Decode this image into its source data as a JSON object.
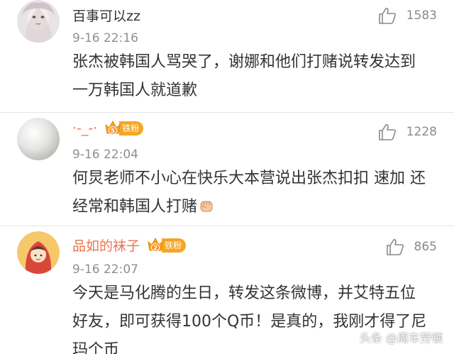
{
  "comments": [
    {
      "username": "百事可以zz",
      "timestamp": "9-16 22:16",
      "text": "张杰被韩国人骂哭了，谢娜和他们打赌说转发达到一万韩国人就道歉",
      "likes": "1583",
      "badge": null
    },
    {
      "username": "·-_-·",
      "timestamp": "9-16 22:04",
      "text": "何炅老师不小心在快乐大本营说出张杰扣扣 速加 还经常和韩国人打赌",
      "likes": "1228",
      "badge": {
        "level": "5",
        "label": "铁粉"
      }
    },
    {
      "username": "品如的袜子",
      "timestamp": "9-16 22:07",
      "text": "今天是马化腾的生日，转发这条微博，并艾特五位好友，即可获得100个Q币！是真的，我刚才得了尼玛个币",
      "likes": "865",
      "badge": {
        "level": "2",
        "label": "铁粉"
      }
    }
  ],
  "watermark": "头条 @周车劳顿",
  "colors": {
    "username_highlight": "#eb7350",
    "badge": "#f5a623",
    "muted": "#8f8f8f"
  },
  "icons": {
    "like": "thumbs-up-icon",
    "badge": "crown-icon",
    "emoji": "fist-emoji-icon"
  }
}
